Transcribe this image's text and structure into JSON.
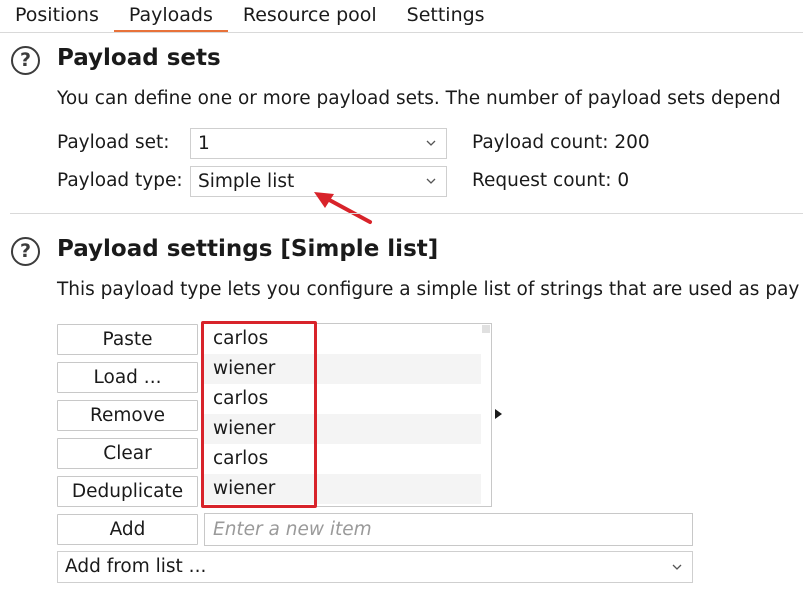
{
  "tabs": [
    {
      "label": "Positions",
      "active": false
    },
    {
      "label": "Payloads",
      "active": true
    },
    {
      "label": "Resource pool",
      "active": false
    },
    {
      "label": "Settings",
      "active": false
    }
  ],
  "payload_sets": {
    "help_glyph": "?",
    "title": "Payload sets",
    "description": "You can define one or more payload sets. The number of payload sets depend",
    "set_label": "Payload set:",
    "set_value": "1",
    "type_label": "Payload type:",
    "type_value": "Simple list",
    "payload_count": "Payload count: 200",
    "request_count": "Request count: 0"
  },
  "payload_settings": {
    "help_glyph": "?",
    "title": "Payload settings [Simple list]",
    "description": "This payload type lets you configure a simple list of strings that are used as pay",
    "buttons": {
      "paste": "Paste",
      "load": "Load ...",
      "remove": "Remove",
      "clear": "Clear",
      "deduplicate": "Deduplicate",
      "add": "Add"
    },
    "list_items": [
      "carlos",
      "wiener",
      "carlos",
      "wiener",
      "carlos",
      "wiener"
    ],
    "new_item_placeholder": "Enter a new item",
    "add_from_list": "Add from list ..."
  },
  "colors": {
    "active_tab_underline": "#e8723a",
    "annotation_red": "#d8232a"
  },
  "icons": {
    "help": "question-circle-icon",
    "dropdown": "chevron-down-icon",
    "expand": "caret-right-icon"
  }
}
